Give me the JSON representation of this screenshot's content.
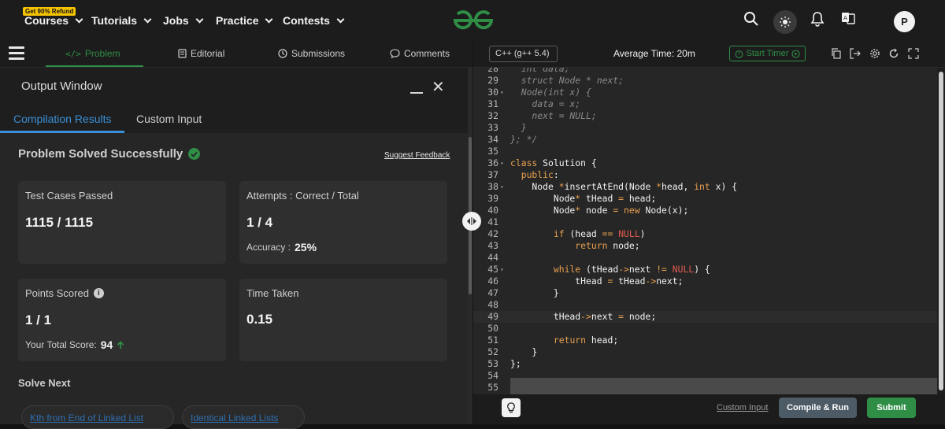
{
  "topnav": {
    "refund_badge": "Get 90% Refund",
    "items": [
      "Courses",
      "Tutorials",
      "Jobs",
      "Practice",
      "Contests"
    ],
    "avatar_letter": "P",
    "brand_color": "#2f8d46"
  },
  "problem_tabs": {
    "problem": "Problem",
    "editorial": "Editorial",
    "submissions": "Submissions",
    "comments": "Comments"
  },
  "output_window": {
    "title": "Output Window",
    "tabs": [
      "Compilation Results",
      "Custom Input"
    ],
    "status": "Problem Solved Successfully",
    "suggest_feedback": "Suggest Feedback",
    "cards": {
      "test_cases": {
        "label": "Test Cases Passed",
        "value": "1115 / 1115"
      },
      "attempts": {
        "label": "Attempts : Correct / Total",
        "value": "1 / 4",
        "accuracy_label": "Accuracy :",
        "accuracy_value": "25%"
      },
      "points": {
        "label": "Points Scored",
        "value": "1 / 1",
        "total_label": "Your Total Score:",
        "total_value": "94"
      },
      "time": {
        "label": "Time Taken",
        "value": "0.15"
      }
    },
    "solve_next_label": "Solve Next",
    "solve_next": [
      "Kth from End of Linked List",
      "Identical Linked Lists"
    ]
  },
  "editor_toolbar": {
    "language": "C++ (g++ 5.4)",
    "average_time": "Average Time: 20m",
    "start_timer": "Start Timer"
  },
  "code_lines": [
    {
      "n": "28",
      "fold": "",
      "html": "<span class=\"cm\">  int data;</span>"
    },
    {
      "n": "29",
      "fold": "",
      "html": "<span class=\"cm\">  struct Node * next;</span>"
    },
    {
      "n": "30",
      "fold": "▾",
      "html": "<span class=\"cm\">  Node(int x) {</span>"
    },
    {
      "n": "31",
      "fold": "",
      "html": "<span class=\"cm\">    data = x;</span>"
    },
    {
      "n": "32",
      "fold": "",
      "html": "<span class=\"cm\">    next = NULL;</span>"
    },
    {
      "n": "33",
      "fold": "",
      "html": "<span class=\"cm\">  }</span>"
    },
    {
      "n": "34",
      "fold": "",
      "html": "<span class=\"cm\">}; */</span>"
    },
    {
      "n": "35",
      "fold": "",
      "html": ""
    },
    {
      "n": "36",
      "fold": "▾",
      "html": "<span class=\"kw\">class</span> Solution {"
    },
    {
      "n": "37",
      "fold": "",
      "html": "  <span class=\"kw\">public</span>:"
    },
    {
      "n": "38",
      "fold": "▾",
      "html": "    Node <span class=\"op\">*</span>insertAtEnd(Node <span class=\"op\">*</span>head, <span class=\"kw\">int</span> x) {"
    },
    {
      "n": "39",
      "fold": "",
      "html": "        Node<span class=\"op\">*</span> tHead <span class=\"op\">=</span> head;"
    },
    {
      "n": "40",
      "fold": "",
      "html": "        Node<span class=\"op\">*</span> node <span class=\"op\">=</span> <span class=\"kw\">new</span> Node(x);"
    },
    {
      "n": "41",
      "fold": "",
      "html": ""
    },
    {
      "n": "42",
      "fold": "",
      "html": "        <span class=\"kw\">if</span> (head <span class=\"op\">==</span> <span class=\"nul\">NULL</span>)"
    },
    {
      "n": "43",
      "fold": "",
      "html": "            <span class=\"kw\">return</span> node;"
    },
    {
      "n": "44",
      "fold": "",
      "html": ""
    },
    {
      "n": "45",
      "fold": "▾",
      "html": "        <span class=\"kw\">while</span> (tHead<span class=\"op\">-&gt;</span>next <span class=\"op\">!=</span> <span class=\"nul\">NULL</span>) {"
    },
    {
      "n": "46",
      "fold": "",
      "html": "            tHead <span class=\"op\">=</span> tHead<span class=\"op\">-&gt;</span>next;"
    },
    {
      "n": "47",
      "fold": "",
      "html": "        }"
    },
    {
      "n": "48",
      "fold": "",
      "html": ""
    },
    {
      "n": "49",
      "fold": "",
      "html": "        tHead<span class=\"op\">-&gt;</span>next <span class=\"op\">=</span> node;"
    },
    {
      "n": "50",
      "fold": "",
      "html": ""
    },
    {
      "n": "51",
      "fold": "",
      "html": "        <span class=\"kw\">return</span> head;"
    },
    {
      "n": "52",
      "fold": "",
      "html": "    }"
    },
    {
      "n": "53",
      "fold": "",
      "html": "};"
    },
    {
      "n": "54",
      "fold": "",
      "html": ""
    },
    {
      "n": "55",
      "fold": "",
      "html": ""
    }
  ],
  "active_line": "49",
  "bottom_bar": {
    "custom_input": "Custom Input",
    "compile_run": "Compile & Run",
    "submit": "Submit"
  }
}
